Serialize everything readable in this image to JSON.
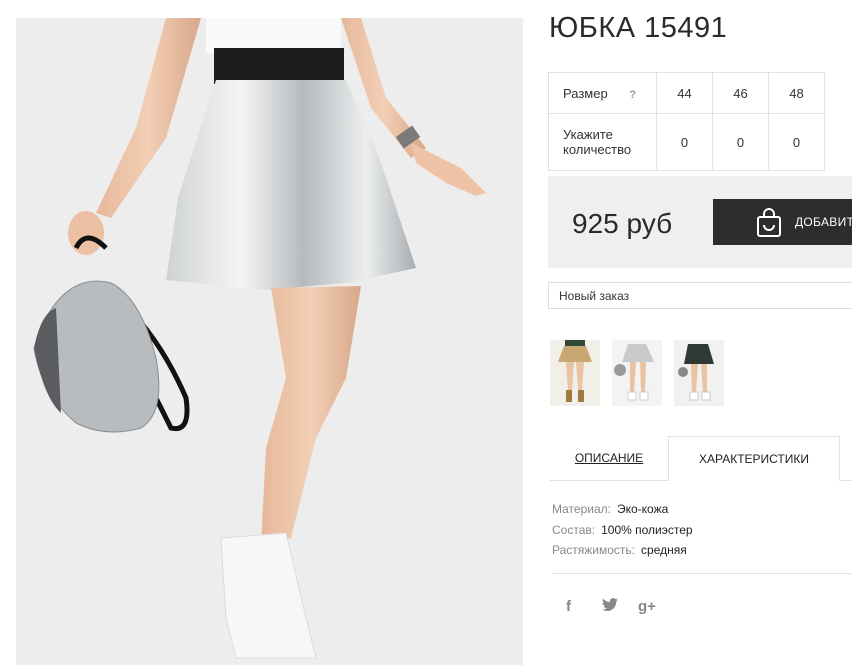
{
  "product": {
    "title": "ЮБКА 15491",
    "size_label": "Размер",
    "help_mark": "?",
    "qty_label_1": "Укажите",
    "qty_label_2": "количество",
    "sizes": [
      "44",
      "46",
      "48"
    ],
    "quantities": [
      "0",
      "0",
      "0"
    ],
    "price": "925 руб",
    "add_button": "ДОБАВИТЬ",
    "order_select": "Новый заказ"
  },
  "tabs": {
    "description": "ОПИСАНИЕ",
    "characteristics": "ХАРАКТЕРИСТИКИ"
  },
  "properties": [
    {
      "label": "Материал:",
      "value": "Эко-кожа"
    },
    {
      "label": "Состав:",
      "value": "100% полиэстер"
    },
    {
      "label": "Растяжимость:",
      "value": "средняя"
    }
  ],
  "social": {
    "facebook": "f",
    "twitter": "t",
    "google": "g+"
  },
  "icons": [
    "bag-icon",
    "facebook-icon",
    "twitter-icon",
    "google-plus-icon"
  ],
  "colors": {
    "button_bg": "#2d2d2d",
    "price_box_bg": "#efefef",
    "thumb_gold": "#c8a870",
    "thumb_silver": "#c9c9c9",
    "thumb_dark": "#2f3a36"
  }
}
